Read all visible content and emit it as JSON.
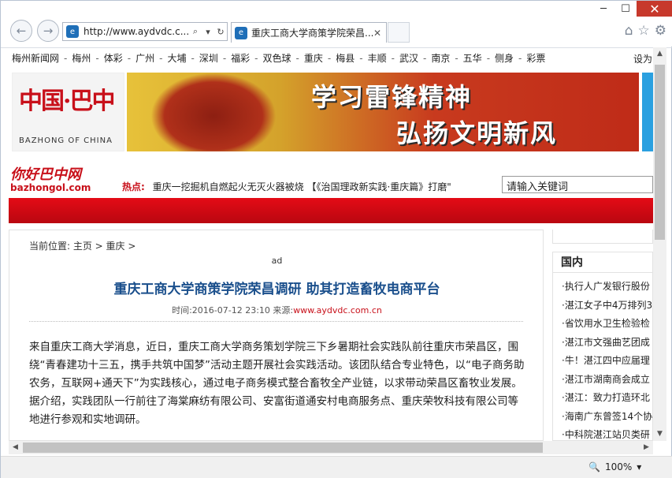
{
  "browser": {
    "address": "http://www.aydvdc.c...",
    "tab_title": "重庆工商大学商策学院荣昌...",
    "zoom": "100%"
  },
  "linkbar": {
    "items": [
      "梅州新闻网",
      "梅州",
      "体彩",
      "广州",
      "大埔",
      "深圳",
      "福彩",
      "双色球",
      "重庆",
      "梅县",
      "丰顺",
      "武汉",
      "南京",
      "五华",
      "侧身",
      "彩票"
    ],
    "right": "设为"
  },
  "banner": {
    "logo_cn": "中国·巴中",
    "logo_en": "BAZHONG OF CHINA",
    "ad_line1": "学习雷锋精神",
    "ad_line2": "弘扬文明新风"
  },
  "site": {
    "logo": "你好巴中网",
    "domain": "bazhongol.com",
    "hot_label": "热点:",
    "hot_text": "重庆一挖掘机自燃起火无灭火器被烧 【《治国理政新实践·重庆篇》打磨\"",
    "search_placeholder": "请输入关键词"
  },
  "article": {
    "breadcrumb": "当前位置: 主页 > 重庆 >",
    "ad_label": "ad",
    "title": "重庆工商大学商策学院荣昌调研 助其打造畜牧电商平台",
    "time_label": "时间:2016-07-12 23:10  来源:",
    "source": "www.aydvdc.com.cn",
    "para1": "来自重庆工商大学消息，近日，重庆工商大学商务策划学院三下乡暑期社会实践队前往重庆市荣昌区，围绕“青春建功十三五，携手共筑中国梦”活动主题开展社会实践活动。该团队结合专业特色，以“电子商务助农务，互联网+通天下”为实践核心，通过电子商务模式整合畜牧全产业链，以求带动荣昌区畜牧业发展。",
    "para2": "据介绍，实践团队一行前往了海棠麻纺有限公司、安富街道通安村电商服务点、重庆荣牧科技有限公司等地进行参观和实地调研。"
  },
  "sidebar": {
    "heading": "国内",
    "items": [
      "·执行人广发银行股份",
      "·湛江女子中4万排列3",
      "·省饮用水卫生检验检",
      "·湛江市文强曲艺团成",
      "·牛！湛江四中应届理",
      "·湛江市湖南商会成立",
      "·湛江：致力打造环北",
      "·海南广东曾签14个协",
      "·中科院湛江站贝类研"
    ]
  }
}
